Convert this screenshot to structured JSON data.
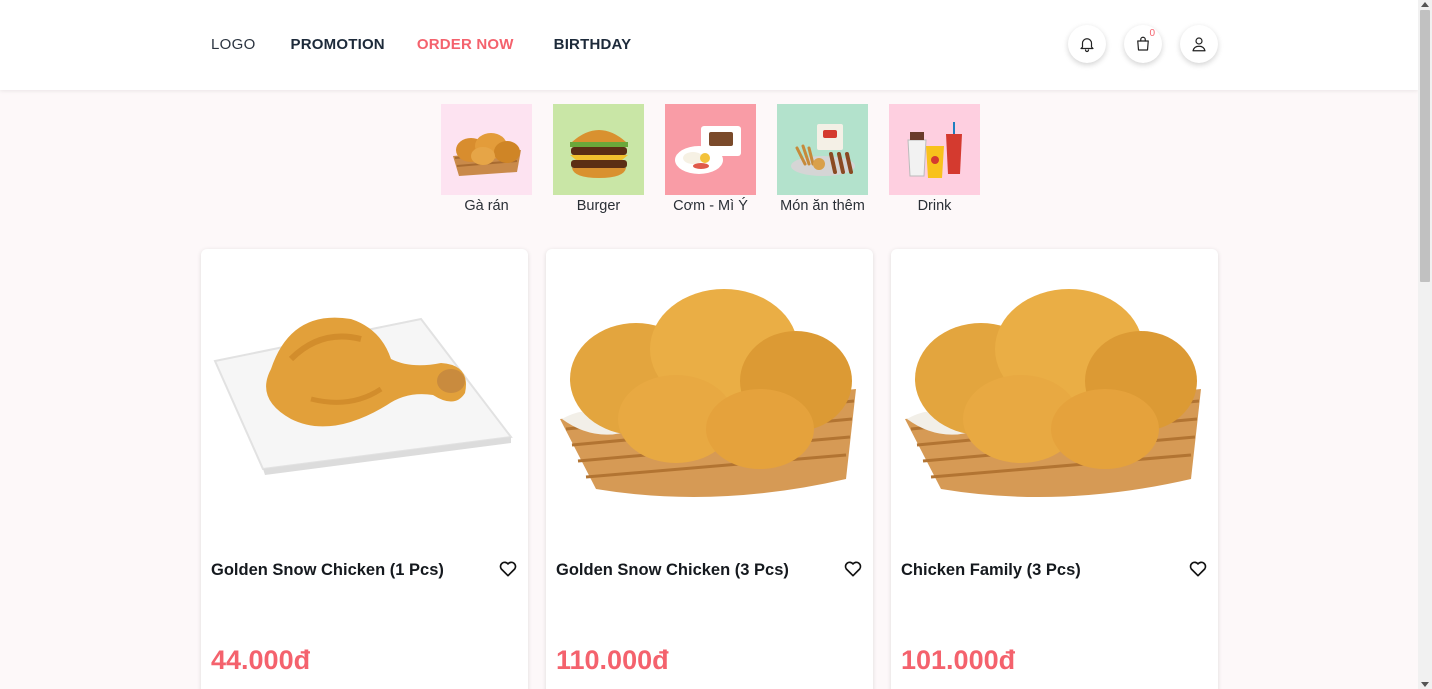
{
  "header": {
    "logo": "LOGO",
    "nav": [
      {
        "label": "PROMOTION",
        "active": false
      },
      {
        "label": "ORDER NOW",
        "active": true
      },
      {
        "label": "BIRTHDAY",
        "active": false
      }
    ],
    "cart_count": "0",
    "icons": [
      "bell-icon",
      "shopping-bag-icon",
      "user-icon"
    ]
  },
  "categories": [
    {
      "label": "Gà rán",
      "bg": "#fde3f1",
      "icon": "fried-chicken-icon"
    },
    {
      "label": "Burger",
      "bg": "#c9e6a6",
      "icon": "burger-icon"
    },
    {
      "label": "Cơm - Mì Ý",
      "bg": "#f99ca6",
      "icon": "rice-plate-icon"
    },
    {
      "label": "Món ăn thêm",
      "bg": "#b3e2cc",
      "icon": "side-dish-icon"
    },
    {
      "label": "Drink",
      "bg": "#fecfe0",
      "icon": "drink-icon"
    }
  ],
  "products": [
    {
      "name": "Golden Snow Chicken (1 Pcs)",
      "price": "44.000đ",
      "image": "chicken-drumstick-plate"
    },
    {
      "name": "Golden Snow Chicken (3 Pcs)",
      "price": "110.000đ",
      "image": "chicken-basket"
    },
    {
      "name": "Chicken Family (3 Pcs)",
      "price": "101.000đ",
      "image": "chicken-basket"
    }
  ],
  "colors": {
    "accent": "#f4626d",
    "nav_text": "#1d2a3a",
    "background": "#fdf8f9"
  }
}
